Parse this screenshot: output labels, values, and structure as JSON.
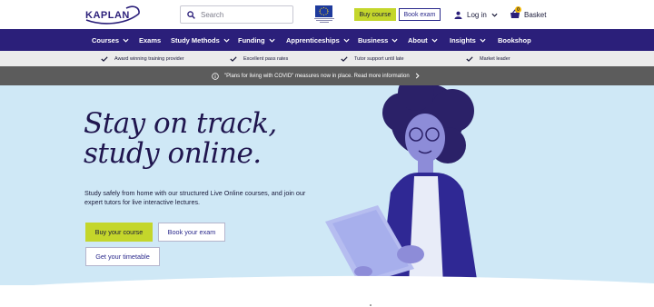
{
  "header": {
    "logo_text": "KAPLAN",
    "search_placeholder": "Search",
    "buy_course_label": "Buy course",
    "book_exam_label": "Book exam",
    "login_label": "Log in",
    "basket_label": "Basket",
    "basket_count": "0"
  },
  "nav": {
    "items": [
      {
        "label": "Courses",
        "has_dropdown": true
      },
      {
        "label": "Exams",
        "has_dropdown": false
      },
      {
        "label": "Study Methods",
        "has_dropdown": true
      },
      {
        "label": "Funding",
        "has_dropdown": true
      },
      {
        "label": "Apprenticeships",
        "has_dropdown": true
      },
      {
        "label": "Business",
        "has_dropdown": true
      },
      {
        "label": "About",
        "has_dropdown": true
      },
      {
        "label": "Insights",
        "has_dropdown": true
      },
      {
        "label": "Bookshop",
        "has_dropdown": false
      }
    ]
  },
  "usp": {
    "items": [
      {
        "label": "Award winning training provider"
      },
      {
        "label": "Excellent pass rates"
      },
      {
        "label": "Tutor support until late"
      },
      {
        "label": "Market leader"
      }
    ]
  },
  "notice": {
    "text": "\"Plans for living with COVID\" measures now in place. Read more information"
  },
  "hero": {
    "title_line1": "Stay on track,",
    "title_line2": "study online.",
    "body": "Study safely from home with our structured Live Online courses, and join our expert tutors for live interactive lectures.",
    "buy_course_label": "Buy your course",
    "book_exam_label": "Book your exam",
    "timetable_label": "Get your timetable"
  },
  "colors": {
    "nav_bg": "#2b1f7a",
    "accent_green": "#c4d62b",
    "hero_bg": "#cfe8f6",
    "notice_bg": "#5c5c5c",
    "usp_bg": "#ebebeb",
    "link_blue": "#2b2a8c"
  },
  "icons": {
    "search": "search-icon",
    "login": "user-icon",
    "basket": "basket-icon",
    "usp_check": "check-icon",
    "notice_info": "info-icon",
    "notice_arrow": "chevron-right-icon",
    "dropdown": "chevron-down-icon"
  }
}
